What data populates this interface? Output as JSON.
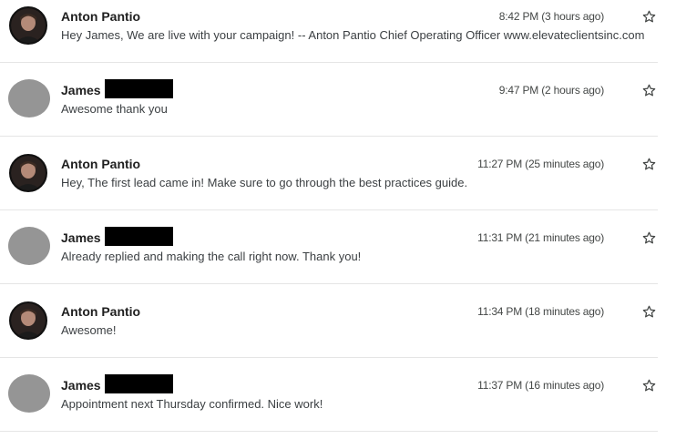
{
  "thread": {
    "messages": [
      {
        "sender": "Anton Pantio",
        "avatar": "profile-photo",
        "redacted": false,
        "time": "8:42 PM (3 hours ago)",
        "snippet": "Hey James, We are live with your campaign! -- Anton Pantio Chief Operating Officer www.elevateclientsinc.com",
        "star_icon": "star-outline-icon"
      },
      {
        "sender": "James",
        "avatar": "gray-placeholder",
        "redacted": true,
        "time": "9:47 PM (2 hours ago)",
        "snippet": "Awesome thank you",
        "star_icon": "star-outline-icon"
      },
      {
        "sender": "Anton Pantio",
        "avatar": "profile-photo",
        "redacted": false,
        "time": "11:27 PM (25 minutes ago)",
        "snippet": "Hey, The first lead came in! Make sure to go through the best practices guide.",
        "star_icon": "star-outline-icon"
      },
      {
        "sender": "James",
        "avatar": "gray-placeholder",
        "redacted": true,
        "time": "11:31 PM (21 minutes ago)",
        "snippet": "Already replied and making the call right now. Thank you!",
        "star_icon": "star-outline-icon"
      },
      {
        "sender": "Anton Pantio",
        "avatar": "profile-photo",
        "redacted": false,
        "time": "11:34 PM (18 minutes ago)",
        "snippet": "Awesome!",
        "star_icon": "star-outline-icon"
      },
      {
        "sender": "James",
        "avatar": "gray-placeholder",
        "redacted": true,
        "time": "11:37 PM (16 minutes ago)",
        "snippet": "Appointment next Thursday confirmed. Nice work!",
        "star_icon": "star-outline-icon"
      }
    ]
  },
  "colors": {
    "sender_text": "#1f1f1f",
    "snippet_text": "#3c4043",
    "time_text": "#444746",
    "divider": "#e5e5e5",
    "placeholder_avatar": "#959595",
    "redaction": "#000000"
  }
}
